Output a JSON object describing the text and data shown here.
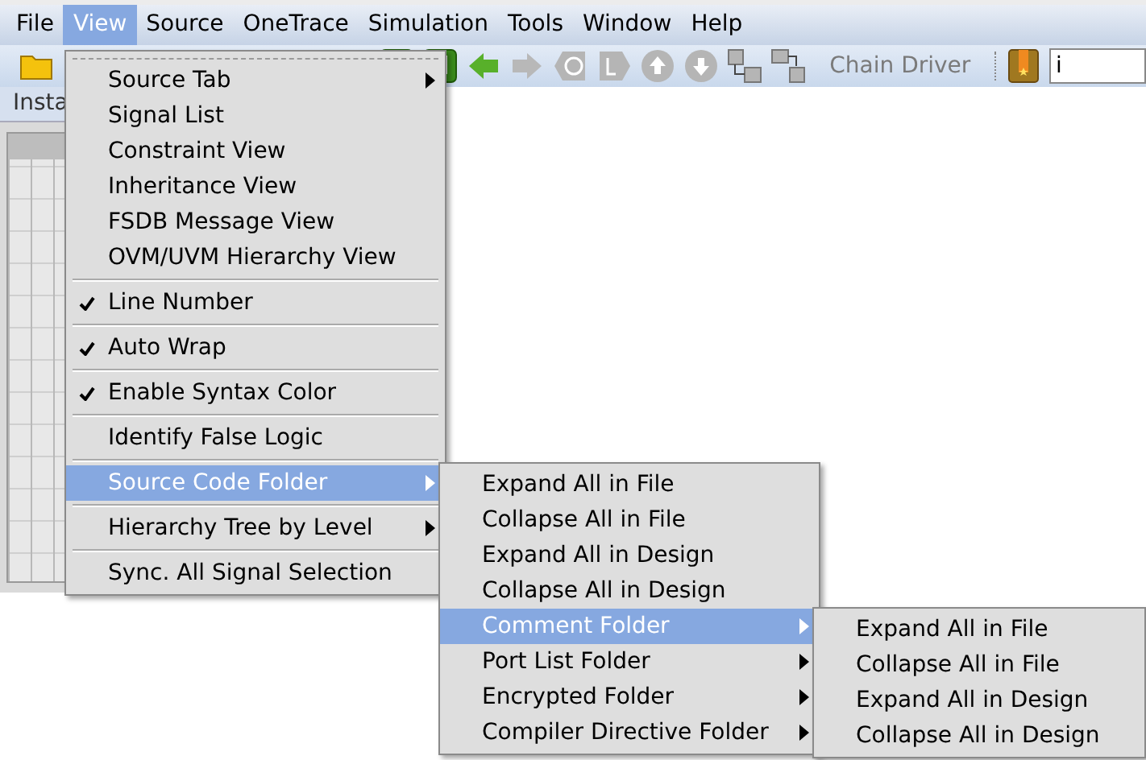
{
  "menubar": [
    {
      "label": "File",
      "selected": false
    },
    {
      "label": "View",
      "selected": true
    },
    {
      "label": "Source",
      "selected": false
    },
    {
      "label": "OneTrace",
      "selected": false
    },
    {
      "label": "Simulation",
      "selected": false
    },
    {
      "label": "Tools",
      "selected": false
    },
    {
      "label": "Window",
      "selected": false
    },
    {
      "label": "Help",
      "selected": false
    }
  ],
  "toolbar": {
    "chain_driver": {
      "label": "Chain Driver",
      "disabled": true
    },
    "search_field": {
      "value": "i"
    }
  },
  "panel_tab": {
    "label": "Insta"
  },
  "view_menu": [
    {
      "kind": "tearoff"
    },
    {
      "kind": "submenu",
      "label": "Source Tab",
      "checked": false,
      "selected": false
    },
    {
      "kind": "item",
      "label": "Signal List",
      "checked": false,
      "selected": false
    },
    {
      "kind": "item",
      "label": "Constraint View",
      "checked": false,
      "selected": false
    },
    {
      "kind": "item",
      "label": "Inheritance View",
      "checked": false,
      "selected": false
    },
    {
      "kind": "item",
      "label": "FSDB Message View",
      "checked": false,
      "selected": false
    },
    {
      "kind": "item",
      "label": "OVM/UVM Hierarchy View",
      "checked": false,
      "selected": false
    },
    {
      "kind": "separator"
    },
    {
      "kind": "item",
      "label": "Line Number",
      "checked": true,
      "selected": false
    },
    {
      "kind": "separator"
    },
    {
      "kind": "item",
      "label": "Auto Wrap",
      "checked": true,
      "selected": false
    },
    {
      "kind": "separator"
    },
    {
      "kind": "item",
      "label": "Enable Syntax Color",
      "checked": true,
      "selected": false
    },
    {
      "kind": "separator"
    },
    {
      "kind": "item",
      "label": "Identify False Logic",
      "checked": false,
      "selected": false
    },
    {
      "kind": "separator"
    },
    {
      "kind": "submenu",
      "label": "Source Code Folder",
      "checked": false,
      "selected": true
    },
    {
      "kind": "separator"
    },
    {
      "kind": "submenu",
      "label": "Hierarchy Tree by Level",
      "checked": false,
      "selected": false
    },
    {
      "kind": "separator"
    },
    {
      "kind": "item",
      "label": "Sync. All Signal Selection",
      "checked": false,
      "selected": false
    }
  ],
  "folder_menu": [
    {
      "kind": "item",
      "label": "Expand All in File",
      "selected": false
    },
    {
      "kind": "item",
      "label": "Collapse All in File",
      "selected": false
    },
    {
      "kind": "item",
      "label": "Expand All in Design",
      "selected": false
    },
    {
      "kind": "item",
      "label": "Collapse All in Design",
      "selected": false
    },
    {
      "kind": "submenu",
      "label": "Comment Folder",
      "selected": true
    },
    {
      "kind": "submenu",
      "label": "Port List Folder",
      "selected": false
    },
    {
      "kind": "submenu",
      "label": "Encrypted Folder",
      "selected": false
    },
    {
      "kind": "submenu",
      "label": "Compiler Directive Folder",
      "selected": false
    }
  ],
  "comment_menu": [
    {
      "kind": "item",
      "label": "Expand All in File",
      "selected": false
    },
    {
      "kind": "item",
      "label": "Collapse All in File",
      "selected": false
    },
    {
      "kind": "item",
      "label": "Expand All in Design",
      "selected": false
    },
    {
      "kind": "item",
      "label": "Collapse All in Design",
      "selected": false
    }
  ]
}
